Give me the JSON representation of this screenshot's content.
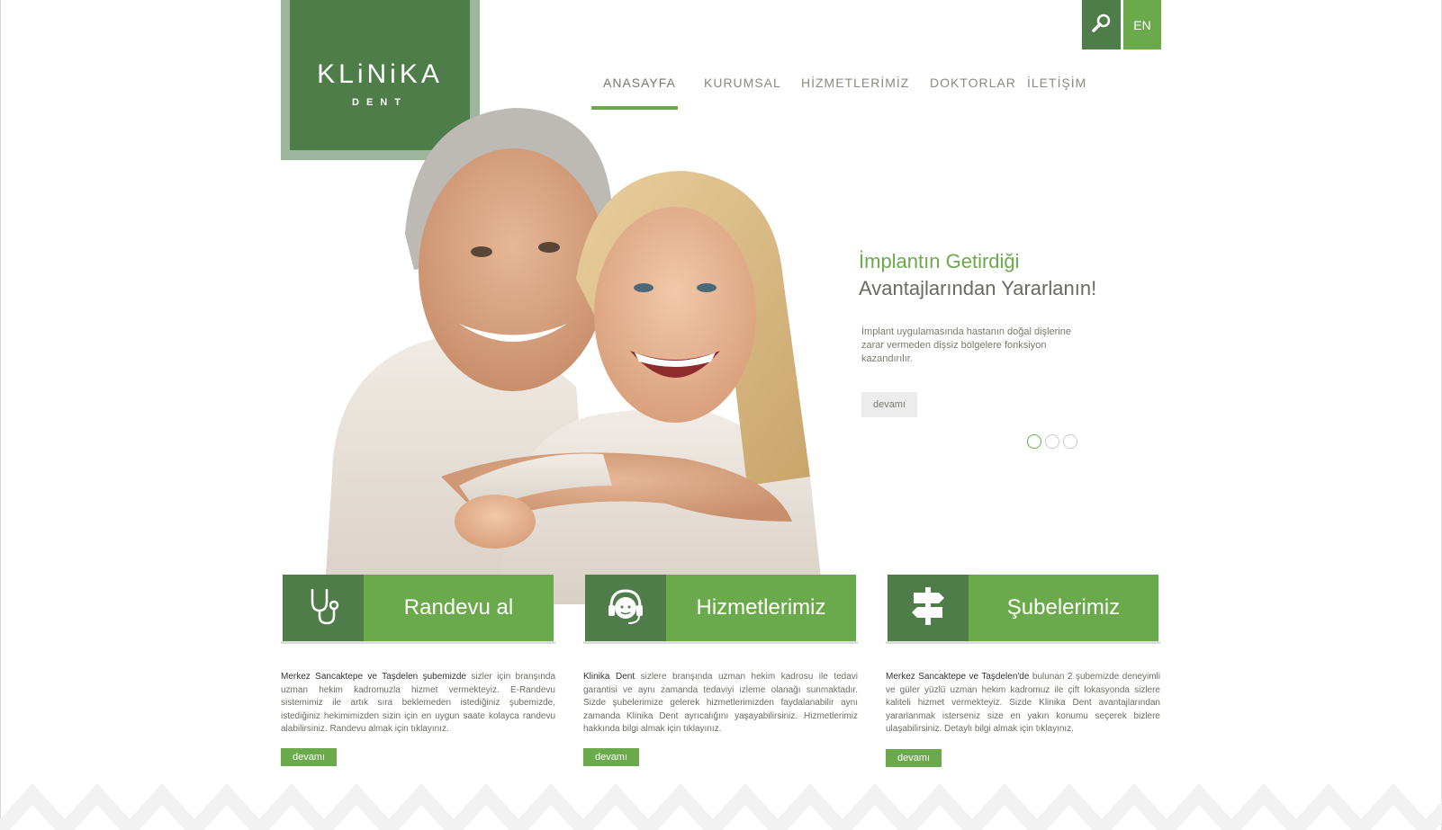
{
  "logo": {
    "main": "KLiNiKA",
    "sub": "DENT"
  },
  "header": {
    "lang_label": "EN",
    "search_icon": "search-icon"
  },
  "nav": {
    "items": [
      {
        "label": "ANASAYFA",
        "active": true
      },
      {
        "label": "KURUMSAL",
        "active": false
      },
      {
        "label": "HİZMETLERİMİZ",
        "active": false
      },
      {
        "label": "DOKTORLAR",
        "active": false
      },
      {
        "label": "İLETİŞİM",
        "active": false
      }
    ]
  },
  "slider": {
    "title_line1": "İmplantın Getirdiği",
    "title_line2": "Avantajlarından Yararlanın!",
    "body": "İmplant uygulamasında  hastanın doğal dişlerine zarar vermeden dişsiz bölgelere fonksiyon kazandırılır.",
    "more_label": "devamı",
    "dots_total": 3,
    "dots_active": 1
  },
  "features": [
    {
      "icon": "stethoscope-icon",
      "label": "Randevu al",
      "lead": "Merkez Sancaktepe ve Taşdelen şubemizde",
      "text": " sizler için branşında uzman hekim kadromuzla hizmet vermekteyiz. E-Randevu sistemimiz ile artık sıra beklemeden istediğiniz şubemizde, istediğiniz hekimimizden sizin için en uygun saate kolayca randevu alabilirsiniz. Randevu almak için tıklayınız.",
      "more_label": "devamı"
    },
    {
      "icon": "support-agent-icon",
      "label": "Hizmetlerimiz",
      "lead": "Klinika Dent",
      "text": " sizlere branşında uzman hekim kadrosu ile tedavi garantisi ve aynı zamanda tedaviyi izleme olanağı sunmaktadır. Sizde şubelerimize gelerek hizmetlerimizden faydalanabilir aynı zamanda Klinika Dent ayrıcalığını yaşayabilirsiniz.  Hizmetlerimiz hakkında bilgi almak için tıklayınız.",
      "more_label": "devamı"
    },
    {
      "icon": "signpost-icon",
      "label": "Şubelerimiz",
      "lead": "Merkez Sancaktepe ve Taşdelen'de",
      "text": " bulunan 2 şubemizde deneyimli ve güler yüzlü uzman hekim kadromuz ile çift lokasyonda sizlere kaliteli hizmet vermekteyiz. Sizde Klinika Dent avantajlarından yararlanmak isterseniz size en yakın konumu seçerek bizlere ulaşabilirsiniz. Detaylı bilgi almak için tıklayınız.",
      "more_label": "devamı"
    }
  ],
  "colors": {
    "brand_dark": "#4e7d4a",
    "brand_light": "#6aaa4c",
    "logo_frame": "#9bb69c"
  }
}
